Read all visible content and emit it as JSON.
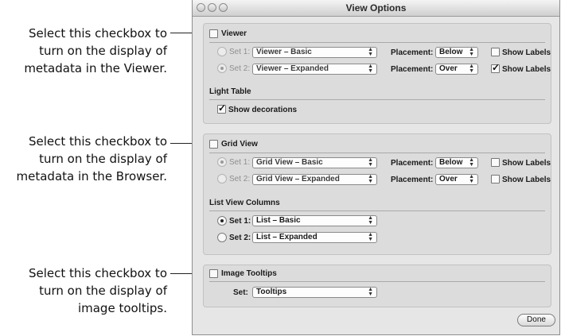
{
  "window": {
    "title": "View Options"
  },
  "callouts": [
    {
      "lines": [
        "Select this checkbox to",
        "turn on the display of",
        "metadata in the Viewer."
      ]
    },
    {
      "lines": [
        "Select this checkbox to",
        "turn on the display of",
        "metadata in the Browser."
      ]
    },
    {
      "lines": [
        "Select this checkbox to",
        "turn on the display of",
        "image tooltips."
      ]
    }
  ],
  "viewer": {
    "label": "Viewer",
    "checked": false,
    "rows": [
      {
        "set_label": "Set 1:",
        "set_value": "Viewer – Basic",
        "placement_label": "Placement:",
        "placement": "Below",
        "show_labels": "Show Labels",
        "show_checked": false,
        "selected": false
      },
      {
        "set_label": "Set 2:",
        "set_value": "Viewer – Expanded",
        "placement_label": "Placement:",
        "placement": "Over",
        "show_labels": "Show Labels",
        "show_checked": true,
        "selected": true
      }
    ]
  },
  "light_table": {
    "label": "Light Table",
    "decorations_label": "Show decorations",
    "decorations_checked": true
  },
  "grid_view": {
    "label": "Grid View",
    "checked": false,
    "rows": [
      {
        "set_label": "Set 1:",
        "set_value": "Grid View – Basic",
        "placement_label": "Placement:",
        "placement": "Below",
        "show_labels": "Show Labels",
        "show_checked": false,
        "selected": true
      },
      {
        "set_label": "Set 2:",
        "set_value": "Grid View – Expanded",
        "placement_label": "Placement:",
        "placement": "Over",
        "show_labels": "Show Labels",
        "show_checked": false,
        "selected": false
      }
    ]
  },
  "list_view": {
    "label": "List View Columns",
    "rows": [
      {
        "set_label": "Set 1:",
        "set_value": "List – Basic",
        "selected": true
      },
      {
        "set_label": "Set 2:",
        "set_value": "List – Expanded",
        "selected": false
      }
    ]
  },
  "tooltips": {
    "label": "Image Tooltips",
    "checked": false,
    "set_label": "Set:",
    "set_value": "Tooltips"
  },
  "done_label": "Done"
}
